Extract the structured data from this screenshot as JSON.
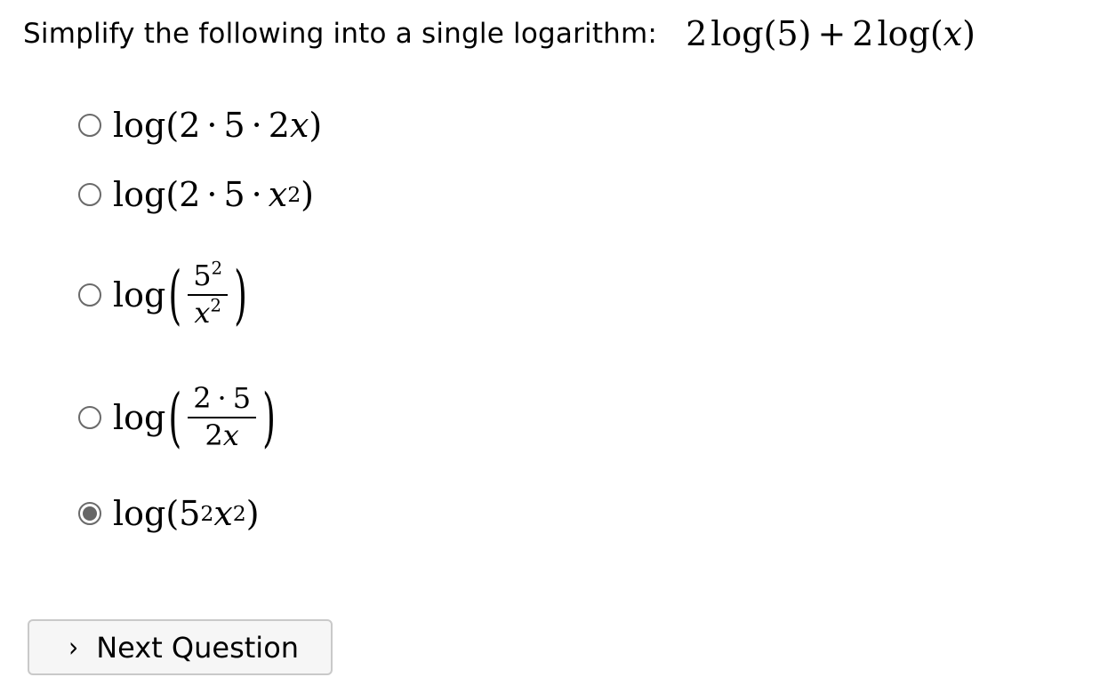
{
  "question": {
    "prompt": "Simplify the following into a single logarithm:",
    "expression": {
      "coef1": "2",
      "fn1": "log",
      "arg1": "(5)",
      "plus": "+",
      "coef2": "2",
      "fn2": "log",
      "open2": "(",
      "var2": "x",
      "close2": ")"
    }
  },
  "options": [
    {
      "fn": "log",
      "open": "(",
      "a": "2",
      "dot1": "·",
      "b": "5",
      "dot2": "·",
      "c": "2",
      "v": "x",
      "close": ")",
      "selected": false
    },
    {
      "fn": "log",
      "open": "(",
      "a": "2",
      "dot1": "·",
      "b": "5",
      "dot2": "·",
      "v": "x",
      "p": "2",
      "close": ")",
      "selected": false
    },
    {
      "fn": "log",
      "open": "(",
      "num_base": "5",
      "num_pow": "2",
      "den_var": "x",
      "den_pow": "2",
      "close": ")",
      "selected": false
    },
    {
      "fn": "log",
      "open": "(",
      "num_a": "2",
      "num_dot": "·",
      "num_b": "5",
      "den_c": "2",
      "den_var": "x",
      "close": ")",
      "selected": false
    },
    {
      "fn": "log",
      "open": "(",
      "base": "5",
      "pow1": "2",
      "v": "x",
      "pow2": "2",
      "close": ")",
      "selected": true
    }
  ],
  "next_button": {
    "icon": "chevron-right-icon",
    "icon_glyph": "›",
    "label": "Next Question"
  }
}
